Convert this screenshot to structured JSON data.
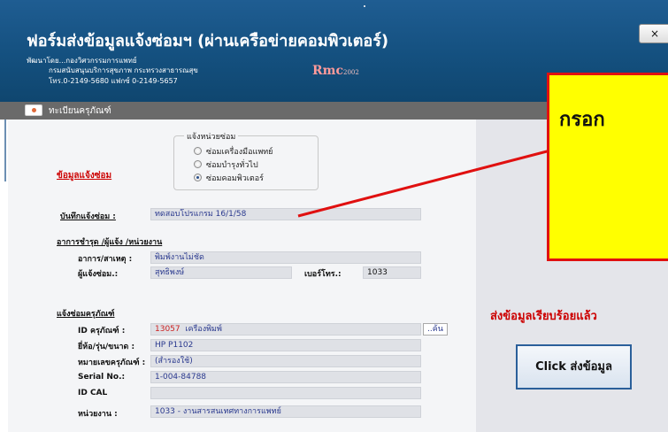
{
  "window": {
    "title": "ฟอร์มส่งข้อมูลแจ้งซ่อมฯ (ผ่านเครือข่ายคอมพิวเตอร์)",
    "developer_line": "พัฒนาโดย...กองวิศวกรรมการแพทย์",
    "org_line": "กรมสนับสนุนบริการสุขภาพ  กระทรวงสาธารณสุข",
    "contact_line": "โทร.0-2149-5680 แฟกซ์ 0-2149-5657",
    "logo_text": "Rmc",
    "logo_sub": "2002",
    "close_label": "×"
  },
  "tab": {
    "label": "ทะเบียนครุภัณฑ์"
  },
  "repair_unit": {
    "legend": "แจ้งหน่วยซ่อม",
    "options": [
      "ซ่อมเครื่องมือแพทย์",
      "ซ่อมบำรุงทั่วไป",
      "ซ่อมคอมพิวเตอร์"
    ],
    "selected": "ซ่อมคอมพิวเตอร์"
  },
  "form": {
    "section_repair_info": "ข้อมูลแจ้งซ่อม",
    "note_label": "บันทึกแจ้งซ่อม :",
    "note_value": "ทดสอบโปรแกรม 16/1/58",
    "section_symptom": "อาการชำรุด /ผู้แจ้ง /หน่วยงาน",
    "cause_label": "อาการ/สาเหตุ :",
    "cause_value": "พิมพ์งานไม่ชัด",
    "reporter_label": "ผู้แจ้งซ่อม.:",
    "reporter_value": "สุทธิพงษ์",
    "phone_label": "เบอร์โทร.:",
    "phone_value": "1033",
    "section_asset": "แจ้งซ่อมครุภัณฑ์",
    "asset_id_label": "ID ครุภัณฑ์ :",
    "asset_id_value": "13057",
    "asset_type_value": "เครื่องพิมพ์",
    "search_button": "..ค้น",
    "brand_label": "ยี่ห้อ/รุ่น/ขนาด :",
    "brand_value": "HP P1102",
    "asset_no_label": "หมายเลขครุภัณฑ์ :",
    "asset_no_value": "(สำรองใช้)",
    "serial_label": "Serial No.:",
    "serial_value": "1-004-84788",
    "idcal_label": "ID CAL",
    "idcal_value": "",
    "dept_label": "หน่วยงาน :",
    "dept_value": "1033 - งานสารสนเทศทางการแพทย์"
  },
  "status": {
    "sent_message": "ส่งข้อมูลเรียบร้อยแล้ว",
    "send_button": "Click ส่งข้อมูล"
  },
  "callout": {
    "text": "กรอก"
  },
  "colors": {
    "header_bg": "#14507f",
    "tab_bar": "#6a6a6a",
    "heading_red": "#cc0000",
    "field_text": "#2b3a8f",
    "callout_fill": "#ffff00",
    "callout_border": "#e01010"
  }
}
